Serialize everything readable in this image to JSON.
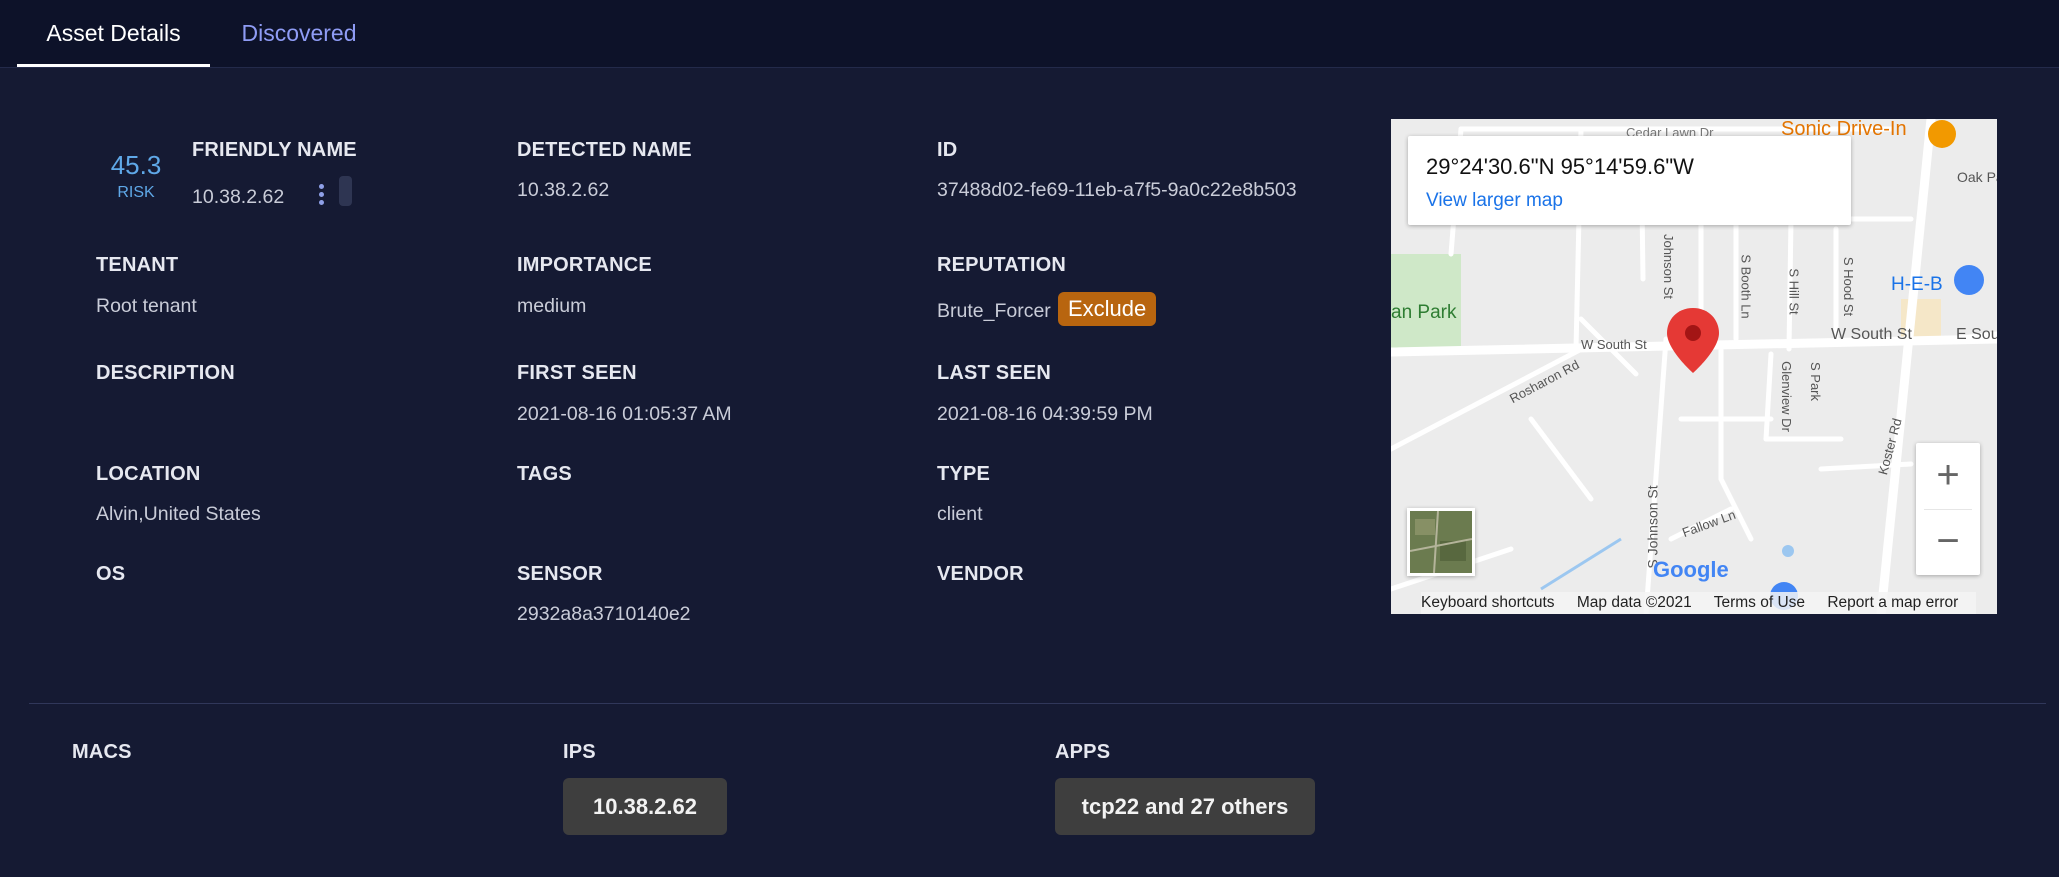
{
  "tabs": {
    "active": "Asset Details",
    "inactive": "Discovered"
  },
  "asset": {
    "risk_score": "45.3",
    "risk_label": "RISK",
    "friendly_name": {
      "label": "FRIENDLY NAME",
      "value": "10.38.2.62"
    },
    "detected_name": {
      "label": "DETECTED NAME",
      "value": "10.38.2.62"
    },
    "id": {
      "label": "ID",
      "value": "37488d02-fe69-11eb-a7f5-9a0c22e8b503"
    },
    "tenant": {
      "label": "TENANT",
      "value": "Root tenant"
    },
    "importance": {
      "label": "IMPORTANCE",
      "value": "medium"
    },
    "reputation": {
      "label": "REPUTATION",
      "value": "Brute_Forcer",
      "badge": "Exclude",
      "badge_color": "#b8650f"
    },
    "description": {
      "label": "DESCRIPTION",
      "value": ""
    },
    "first_seen": {
      "label": "FIRST SEEN",
      "value": "2021-08-16 01:05:37 AM"
    },
    "last_seen": {
      "label": "LAST SEEN",
      "value": "2021-08-16 04:39:59 PM"
    },
    "location": {
      "label": "LOCATION",
      "value": "Alvin,United States"
    },
    "tags": {
      "label": "TAGS",
      "value": ""
    },
    "type": {
      "label": "TYPE",
      "value": "client"
    },
    "os": {
      "label": "OS",
      "value": ""
    },
    "sensor": {
      "label": "SENSOR",
      "value": "2932a8a3710140e2"
    },
    "vendor": {
      "label": "VENDOR",
      "value": ""
    }
  },
  "map": {
    "coords": "29°24'30.6\"N 95°14'59.6\"W",
    "view_larger": "View larger map",
    "zoom_in": "+",
    "zoom_out": "−",
    "footer": {
      "shortcuts": "Keyboard shortcuts",
      "data": "Map data ©2021",
      "terms": "Terms of Use",
      "report": "Report a map error"
    },
    "labels": {
      "cedar": "Cedar Lawn Dr",
      "sonic": "Sonic Drive-In",
      "oak": "Oak Pa",
      "park": "an Park",
      "heb": "H-E-B",
      "w_south_st_left": "W South St",
      "w_south_st_right": "W South St",
      "e_sou": "E Sou",
      "rosharon": "Rosharon Rd",
      "glenview": "Glenview Dr",
      "s_park": "S Park",
      "koster": "Koster Rd",
      "s_johnson": "S Johnson St",
      "johnson_st": "Johnson St",
      "s_booth": "S Booth Ln",
      "s_hill": "S Hill St",
      "s_hood": "S Hood St",
      "fallow": "Fallow Ln",
      "google": "Google"
    }
  },
  "lists": {
    "macs": {
      "label": "MACS"
    },
    "ips": {
      "label": "IPS",
      "value": "10.38.2.62"
    },
    "apps": {
      "label": "APPS",
      "value": "tcp22 and 27 others"
    }
  },
  "colors": {
    "background": "#151a33",
    "tabbar": "#0d1229",
    "accent_blue": "#5fa8e8",
    "tab_inactive": "#8f9cf5",
    "pill": "#3e3e3e"
  }
}
